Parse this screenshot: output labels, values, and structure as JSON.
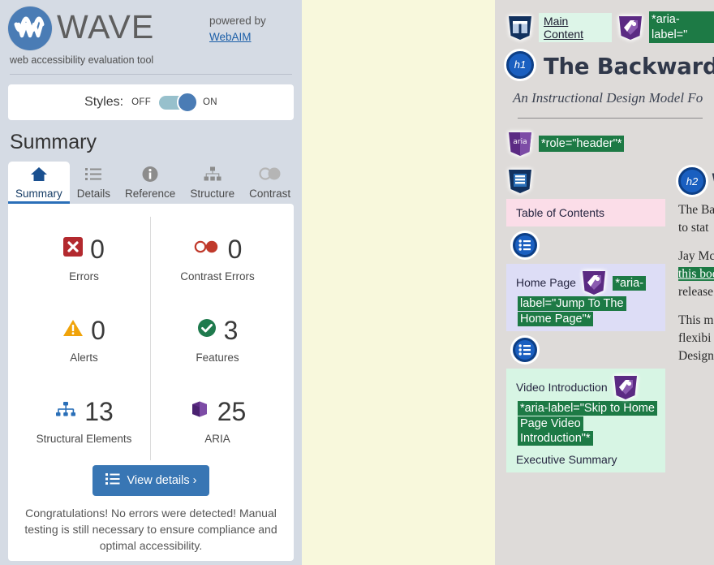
{
  "sidebar": {
    "brand": {
      "wordmark": "WAVE",
      "tagline": "web accessibility evaluation tool",
      "powered_by": "powered by",
      "powered_link": "WebAIM"
    },
    "styles_card": {
      "label": "Styles:",
      "off": "OFF",
      "on": "ON",
      "state": "ON"
    },
    "summary_heading": "Summary",
    "tabs": [
      {
        "label": "Summary",
        "icon": "home-icon",
        "active": true
      },
      {
        "label": "Details",
        "icon": "list-icon",
        "active": false
      },
      {
        "label": "Reference",
        "icon": "info-icon",
        "active": false
      },
      {
        "label": "Structure",
        "icon": "tree-icon",
        "active": false
      },
      {
        "label": "Contrast",
        "icon": "contrast-icon",
        "active": false
      }
    ],
    "stats": [
      {
        "value": "0",
        "caption": "Errors",
        "icon": "error-x-icon",
        "color": "#b3292e"
      },
      {
        "value": "0",
        "caption": "Contrast Errors",
        "icon": "contrast-icon",
        "color": "#c0392b"
      },
      {
        "value": "0",
        "caption": "Alerts",
        "icon": "alert-triangle-icon",
        "color": "#f0a30a"
      },
      {
        "value": "3",
        "caption": "Features",
        "icon": "check-circle-icon",
        "color": "#1f7a4d"
      },
      {
        "value": "13",
        "caption": "Structural Elements",
        "icon": "tree-icon",
        "color": "#2a6fb8"
      },
      {
        "value": "25",
        "caption": "ARIA",
        "icon": "cube-icon",
        "color": "#5b2a83"
      }
    ],
    "view_details_label": "View details ›",
    "congrats": "Congratulations! No errors were detected! Manual testing is still necessary to ensure compliance and optimal accessibility."
  },
  "page": {
    "main_content_link": "Main Content",
    "aria_label_tag_top": "*aria-label=\"",
    "title": "The Backwards D",
    "subtitle": "An Instructional Design Model Fo",
    "role_header_tag": "*role=\"header\"*",
    "nav_blocks": [
      {
        "label": "Table of Contents",
        "tag": "",
        "style": "pink"
      },
      {
        "label": "Home Page",
        "tag": "*aria-label=\"Jump To The Home Page\"*",
        "style": "lavender"
      },
      {
        "label": "Video Introduction",
        "tag": "*aria-label=\"Skip to Home Page Video Introduction\"*",
        "style": "mint"
      },
      {
        "label": "Executive Summary",
        "tag": "",
        "style": "mint"
      }
    ],
    "h2_badge": "h2",
    "h1_badge": "h1",
    "aria_badge": "aria",
    "paragraphs": [
      {
        "pre": "The Ba",
        "link": "",
        "post": ""
      },
      {
        "pre": "to stat",
        "link": "",
        "post": ""
      },
      {
        "pre": "Jay Mc",
        "link": "",
        "post": ""
      },
      {
        "pre": "",
        "link": "this boo",
        "post": ""
      },
      {
        "pre": "release",
        "link": "",
        "post": ""
      },
      {
        "pre": "This m",
        "link": "",
        "post": ""
      },
      {
        "pre": "flexibi",
        "link": "",
        "post": ""
      },
      {
        "pre": "Design",
        "link": "",
        "post": ""
      }
    ]
  }
}
